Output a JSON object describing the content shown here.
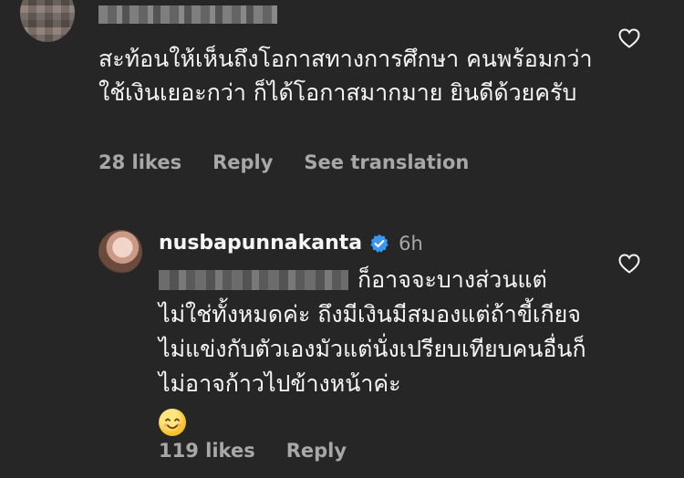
{
  "top_comment": {
    "text": "สะท้อนให้เห็นถึงโอกาสทางการศึกษา คนพร้อมกว่า ใช้เงินเยอะกว่า ก็ได้โอกาสมากมาย ยินดีด้วยครับ",
    "likes": "28 likes",
    "reply_label": "Reply",
    "translate_label": "See translation"
  },
  "reply": {
    "username": "nusbapunnakanta",
    "time": "6h",
    "text": "ก็อาจจะบางส่วนแต่ไม่ใช่ทั้งหมดค่ะ ถึงมีเงินมีสมองแต่ถ้าขี้เกียจ ไม่แข่งกับตัวเองมัวแต่นั่งเปรียบเทียบคนอื่นก็ไม่อาจก้าวไปข้างหน้าค่ะ",
    "emoji": "smiling-face-emoji",
    "likes": "119 likes",
    "reply_label": "Reply"
  },
  "colors": {
    "background": "#262626",
    "text": "#f5f5f5",
    "muted": "#a8a8a8",
    "verified": "#3897f0"
  }
}
